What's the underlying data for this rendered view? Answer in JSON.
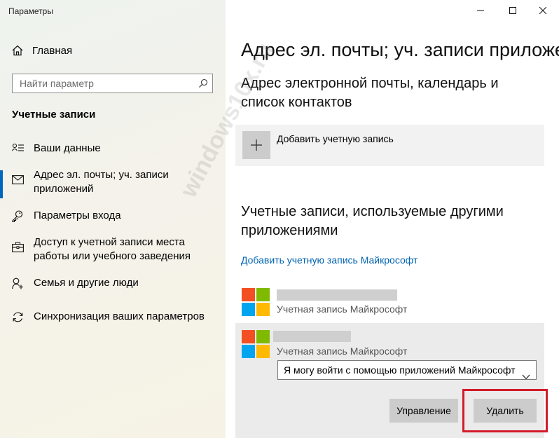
{
  "window": {
    "title": "Параметры",
    "controls": [
      "minimize",
      "maximize",
      "close"
    ]
  },
  "sidebar": {
    "home_label": "Главная",
    "search_placeholder": "Найти параметр",
    "section_title": "Учетные записи",
    "items": [
      {
        "label": "Ваши данные",
        "icon": "person-card-icon"
      },
      {
        "label": "Адрес эл. почты; уч. записи приложений",
        "icon": "mail-icon",
        "active": true
      },
      {
        "label": "Параметры входа",
        "icon": "key-icon"
      },
      {
        "label": "Доступ к учетной записи места работы или учебного заведения",
        "icon": "briefcase-icon"
      },
      {
        "label": "Семья и другие люди",
        "icon": "person-add-icon"
      },
      {
        "label": "Синхронизация ваших параметров",
        "icon": "sync-icon"
      }
    ]
  },
  "main": {
    "page_title": "Адрес эл. почты; уч. записи приложений",
    "email_section_title": "Адрес электронной почты, календарь и список контактов",
    "add_account_label": "Добавить учетную запись",
    "other_apps_title": "Учетные записи, используемые другими приложениями",
    "add_ms_link": "Добавить учетную запись Майкрософт",
    "accounts": [
      {
        "subtitle": "Учетная запись Майкрософт"
      },
      {
        "subtitle": "Учетная запись Майкрософт",
        "selected": true,
        "dropdown_value": "Я могу войти с помощью приложений Майкрософт"
      }
    ],
    "manage_button": "Управление",
    "delete_button": "Удалить"
  },
  "watermark": "windows10x.ru",
  "colors": {
    "accent": "#0067c0",
    "link": "#0063b1",
    "highlight_border": "#d31b2a",
    "ms_red": "#f25022",
    "ms_green": "#7fba00",
    "ms_blue": "#00a4ef",
    "ms_yellow": "#ffb900"
  }
}
